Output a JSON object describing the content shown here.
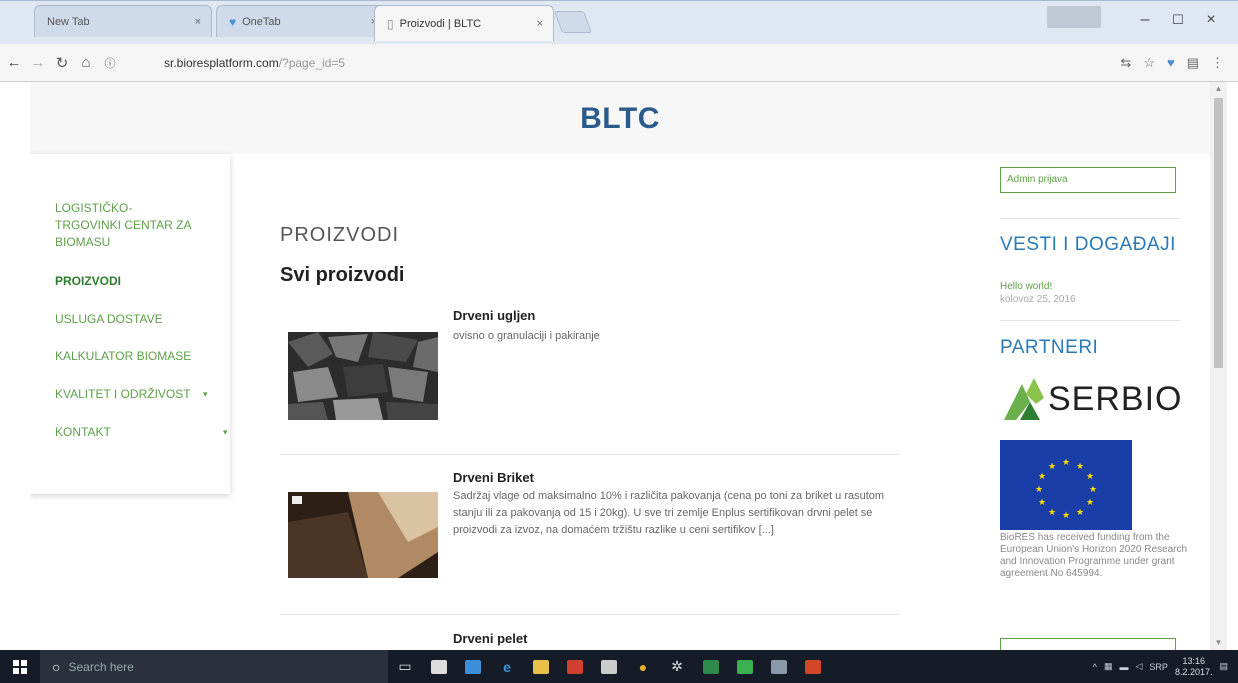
{
  "browser": {
    "tabs": [
      {
        "label": "New Tab",
        "active": false
      },
      {
        "label": "OneTab",
        "active": false
      },
      {
        "label": "Proizvodi | BLTC",
        "active": true
      }
    ],
    "user_badge": "",
    "url_host": "sr.bioresplatform.com",
    "url_path": "/?page_id=5"
  },
  "site": {
    "title": "BLTC"
  },
  "nav": {
    "items": [
      {
        "label": "LOGISTIČKO-",
        "label2": "TRGOVINKI CENTAR ZA",
        "label3": "BIOMASU"
      },
      {
        "label": "PROIZVODI"
      },
      {
        "label": "USLUGA DOSTAVE"
      },
      {
        "label": "KALKULATOR BIOMASE"
      },
      {
        "label": "KVALITET I ODRŽIVOST"
      },
      {
        "label": "KONTAKT"
      }
    ]
  },
  "main": {
    "section_title": "PROIZVODI",
    "subtitle": "Svi proizvodi",
    "products": [
      {
        "title": "Drveni ugljen",
        "desc": "ovisno o granulaciji i pakiranje"
      },
      {
        "title": "Drveni Briket",
        "desc": "Sadržaj vlage od maksimalno 10% i različita pakovanja (cena po toni za briket u rasutom stanju ili za pakovanja od 15 i 20kg). U sve tri zemlje Enplus sertifikovan drvni pelet se proizvodi za izvoz, na domaćem tržištu razlike u ceni sertifikov [...]"
      },
      {
        "title": "Drveni pelet",
        "desc": ""
      }
    ]
  },
  "sidebar": {
    "login": "Admin prijava",
    "news_heading": "VESTI I DOGAĐAJI",
    "news_link": "Hello world!",
    "news_date": "kolovoz 25, 2016",
    "partners_heading": "PARTNERI",
    "serbio_logo": "SERBIO",
    "eu_text": "BioRES has received funding from the European Union's Horizon 2020 Research and Innovation Programme under grant agreement No 645994."
  },
  "taskbar": {
    "search_placeholder": "Search here",
    "time": "13:16",
    "date": "8.2.2017.",
    "lang": "SRP"
  },
  "colors": {
    "accent_green": "#5da14a",
    "title_blue": "#2b5a8c",
    "heading_blue": "#2a7bb5"
  }
}
